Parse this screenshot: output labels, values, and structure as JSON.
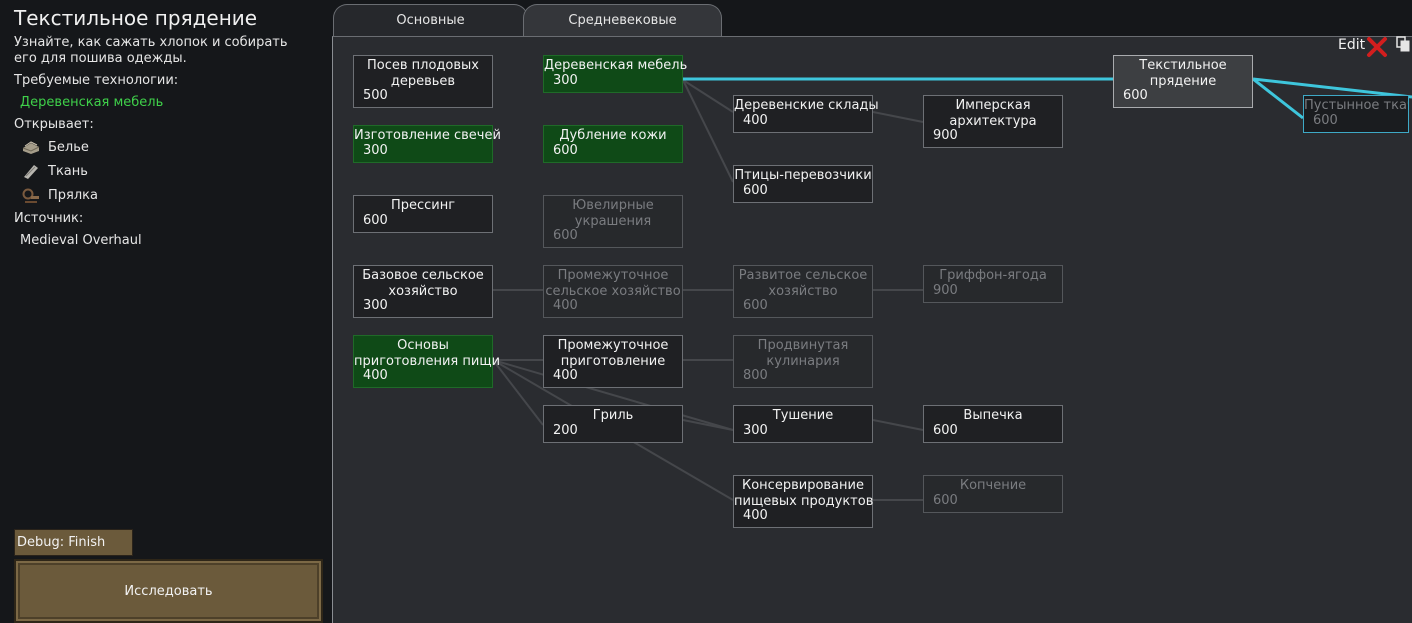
{
  "sidebar": {
    "title": "Текстильное прядение",
    "description": "Узнайте, как сажать хлопок и собирать его для пошива одежды.",
    "required_label": "Требуемые технологии:",
    "required_value": "Деревенская мебель",
    "unlocks_label": "Открывает:",
    "unlocks": [
      {
        "label": "Белье",
        "icon": "linen-icon"
      },
      {
        "label": "Ткань",
        "icon": "cloth-icon"
      },
      {
        "label": "Прялка",
        "icon": "spinning-wheel-icon"
      }
    ],
    "source_label": "Источник:",
    "source_value": "Medieval Overhaul",
    "debug_button": "Debug: Finish now",
    "research_button": "Исследовать"
  },
  "tabs": [
    {
      "label": "Основные",
      "active": false
    },
    {
      "label": "Средневековые",
      "active": true
    }
  ],
  "toolbar": {
    "edit_label": "Edit"
  },
  "colors": {
    "accent_line": "#3ec6dc",
    "completed": "#0f4a17",
    "completed_text": "#3fd14a"
  },
  "nodes": [
    {
      "id": "posev",
      "title": "Посев плодовых деревьев",
      "lines": [
        "Посев плодовых",
        "деревьев"
      ],
      "cost": "500",
      "state": "available"
    },
    {
      "id": "derevmeb",
      "title": "Деревенская мебель",
      "lines": [
        "Деревенская мебель"
      ],
      "cost": "300",
      "state": "done"
    },
    {
      "id": "svechi",
      "title": "Изготовление свечей",
      "lines": [
        "Изготовление свечей"
      ],
      "cost": "300",
      "state": "done"
    },
    {
      "id": "kozha",
      "title": "Дубление кожи",
      "lines": [
        "Дубление кожи"
      ],
      "cost": "600",
      "state": "done"
    },
    {
      "id": "pressing",
      "title": "Прессинг",
      "lines": [
        "Прессинг"
      ],
      "cost": "600",
      "state": "available"
    },
    {
      "id": "yuvel",
      "title": "Ювелирные украшения",
      "lines": [
        "Ювелирные",
        "украшения"
      ],
      "cost": "600",
      "state": "locked"
    },
    {
      "id": "baz_selhoz",
      "title": "Базовое сельское хозяйство",
      "lines": [
        "Базовое сельское",
        "хозяйство"
      ],
      "cost": "300",
      "state": "available"
    },
    {
      "id": "prom_selhoz",
      "title": "Промежуточное сельское хозяйство",
      "lines": [
        "Промежуточное",
        "сельское хозяйство"
      ],
      "cost": "400",
      "state": "locked"
    },
    {
      "id": "razv_selhoz",
      "title": "Развитое сельское хозяйство",
      "lines": [
        "Развитое сельское",
        "хозяйство"
      ],
      "cost": "600",
      "state": "locked"
    },
    {
      "id": "griffon",
      "title": "Гриффон-ягода",
      "lines": [
        "Гриффон-ягода"
      ],
      "cost": "900",
      "state": "locked"
    },
    {
      "id": "osn_pishi",
      "title": "Основы приготовления пищи",
      "lines": [
        "Основы",
        "приготовления пищи"
      ],
      "cost": "400",
      "state": "done"
    },
    {
      "id": "prom_prig",
      "title": "Промежуточное приготовление",
      "lines": [
        "Промежуточное",
        "приготовление"
      ],
      "cost": "400",
      "state": "available"
    },
    {
      "id": "kulinar",
      "title": "Продвинутая кулинария",
      "lines": [
        "Продвинутая",
        "кулинария"
      ],
      "cost": "800",
      "state": "locked"
    },
    {
      "id": "gril",
      "title": "Гриль",
      "lines": [
        "Гриль"
      ],
      "cost": "200",
      "state": "available"
    },
    {
      "id": "tushenie",
      "title": "Тушение",
      "lines": [
        "Тушение"
      ],
      "cost": "300",
      "state": "available"
    },
    {
      "id": "vypechka",
      "title": "Выпечка",
      "lines": [
        "Выпечка"
      ],
      "cost": "600",
      "state": "available"
    },
    {
      "id": "konserv",
      "title": "Консервирование пищевых продуктов",
      "lines": [
        "Консервирование",
        "пищевых продуктов"
      ],
      "cost": "400",
      "state": "available"
    },
    {
      "id": "kopchenie",
      "title": "Копчение",
      "lines": [
        "Копчение"
      ],
      "cost": "600",
      "state": "locked"
    },
    {
      "id": "sklady",
      "title": "Деревенские склады",
      "lines": [
        "Деревенские склады"
      ],
      "cost": "400",
      "state": "available"
    },
    {
      "id": "pticy",
      "title": "Птицы-перевозчики",
      "lines": [
        "Птицы-перевозчики"
      ],
      "cost": "600",
      "state": "available"
    },
    {
      "id": "imper",
      "title": "Имперская архитектура",
      "lines": [
        "Имперская",
        "архитектура"
      ],
      "cost": "900",
      "state": "available"
    },
    {
      "id": "tekstil",
      "title": "Текстильное прядение",
      "lines": [
        "Текстильное",
        "прядение"
      ],
      "cost": "600",
      "state": "selected"
    },
    {
      "id": "pustyn",
      "title": "Пустынное ткачество",
      "lines": [
        "Пустынное ткаче"
      ],
      "cost": "600",
      "state": "next"
    }
  ]
}
